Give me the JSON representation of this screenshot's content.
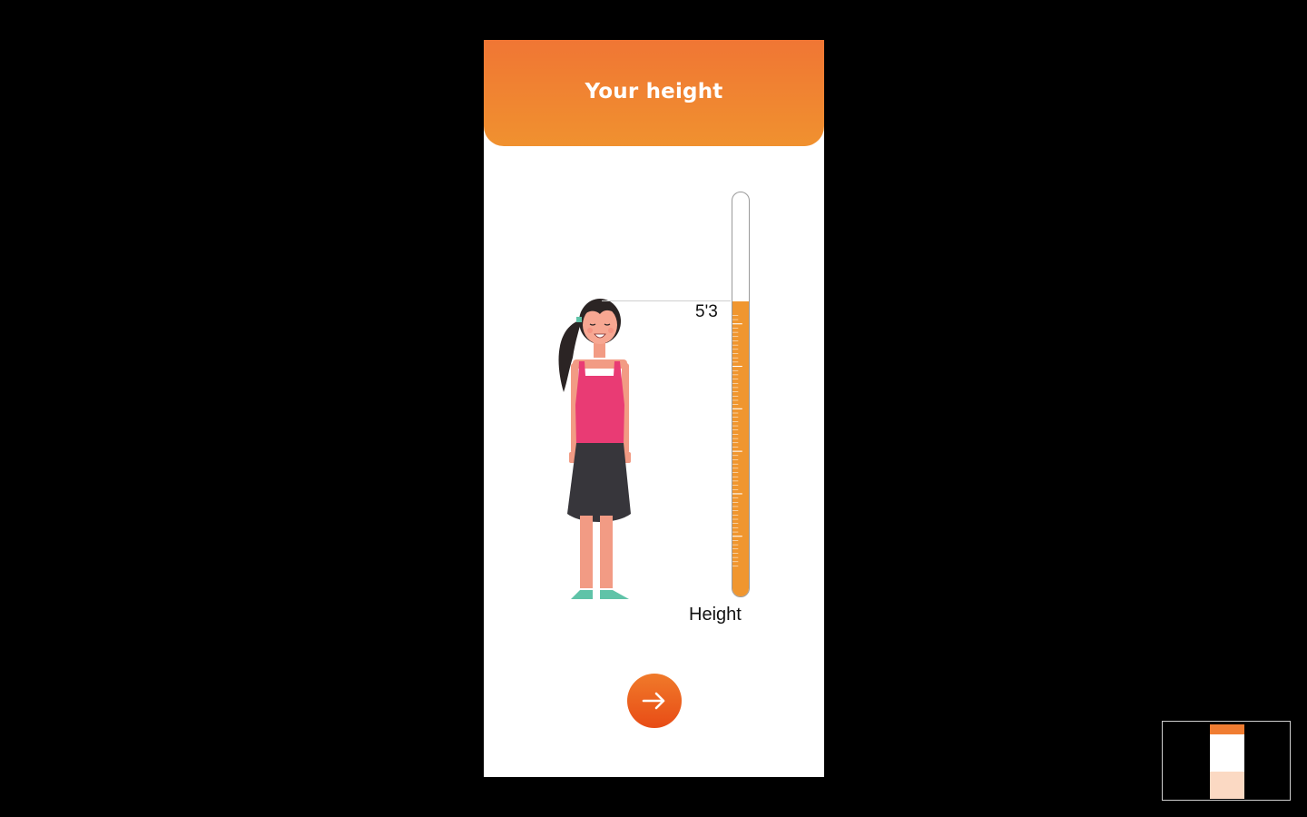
{
  "header": {
    "title": "Your height"
  },
  "measurement": {
    "value_label": "5'3",
    "axis_label": "Height",
    "fill_fraction": 0.73
  },
  "next_button": {
    "icon": "arrow-right-icon"
  },
  "colors": {
    "header_gradient_top": "#f07634",
    "header_gradient_bottom": "#f0912f",
    "tube_fill": "#f0962f",
    "button_top": "#f07a2a",
    "button_bottom": "#e84c16",
    "shirt": "#e93b74",
    "skirt": "#37363b",
    "skin": "#f29b84",
    "hair": "#2b2424",
    "shoes": "#5fc3a8"
  },
  "minimap": {
    "visible": true
  }
}
